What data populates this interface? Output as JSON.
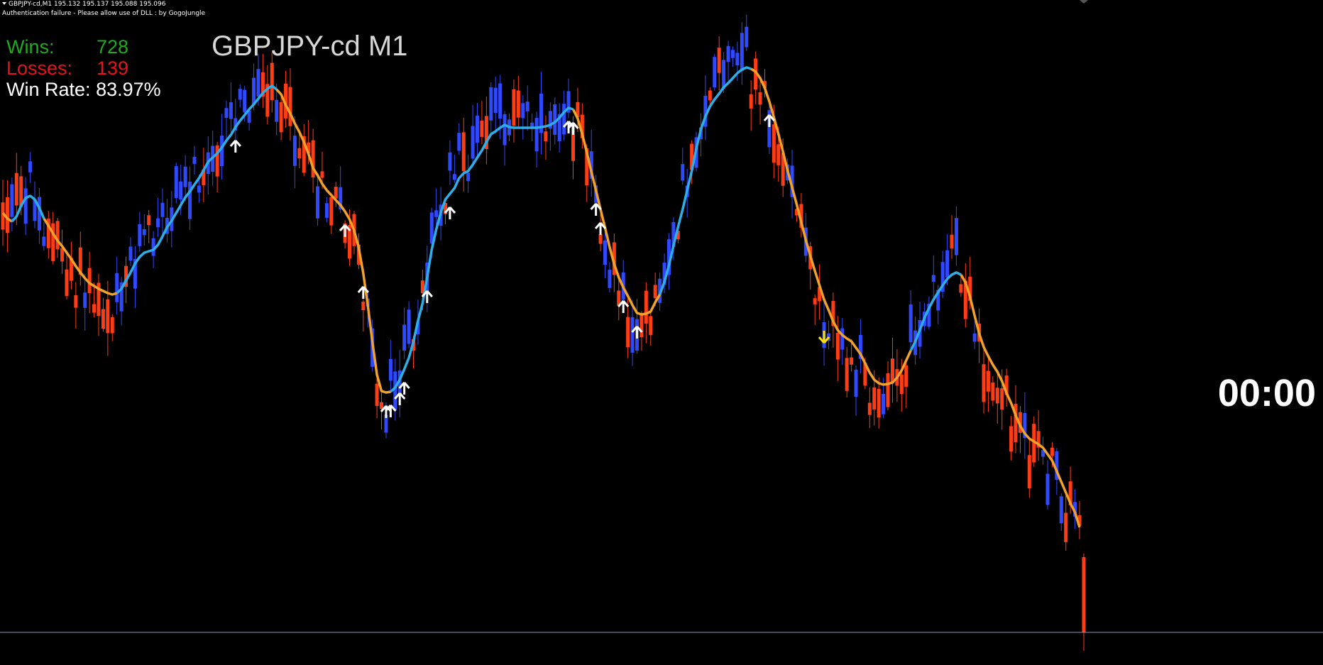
{
  "header": {
    "symbol_line": "GBPJPY-cd,M1  195.132 195.137 195.088 195.096",
    "auth_line": "Authentication failure - Please allow use of DLL : by GogoJungle"
  },
  "stats": {
    "wins_label": "Wins:",
    "wins_value": "728",
    "losses_label": "Losses:",
    "losses_value": "139",
    "winrate_label": "Win Rate:",
    "winrate_value": "83.97%"
  },
  "chart_title": "GBPJPY-cd M1",
  "countdown": "00:00",
  "colors": {
    "background": "#000000",
    "bull_candle": "#2f49ff",
    "bear_candle": "#ff3d14",
    "ma_up": "#2eaee6",
    "ma_down": "#f0a22a",
    "arrow_up": "#ffffff",
    "arrow_down": "#ffe000",
    "current_price_line": "#8d94b8",
    "wins_text": "#1faa1f",
    "losses_text": "#e8121b"
  },
  "icons": {
    "buy_signal": "arrow-up-icon",
    "sell_signal": "arrow-down-icon"
  },
  "chart_data": {
    "type": "candlestick",
    "symbol": "GBPJPY-cd",
    "timeframe": "M1",
    "last_bar": {
      "open": 195.132,
      "high": 195.137,
      "low": 195.088,
      "close": 195.096
    },
    "moving_average_line": [
      300,
      308,
      312,
      305,
      290,
      279,
      276,
      281,
      293,
      308,
      318,
      329,
      339,
      347,
      356,
      365,
      375,
      384,
      392,
      399,
      403,
      407,
      410,
      413,
      415,
      413,
      407,
      395,
      384,
      371,
      362,
      356,
      354,
      352,
      345,
      333,
      320,
      311,
      300,
      289,
      278,
      270,
      260,
      251,
      240,
      228,
      222,
      216,
      208,
      198,
      190,
      179,
      170,
      162,
      154,
      147,
      139,
      131,
      125,
      121,
      126,
      133,
      148,
      160,
      174,
      186,
      200,
      217,
      237,
      247,
      259,
      268,
      275,
      282,
      289,
      298,
      309,
      325,
      349,
      385,
      430,
      482,
      528,
      551,
      553,
      552,
      546,
      535,
      520,
      504,
      481,
      452,
      427,
      391,
      352,
      323,
      299,
      281,
      273,
      265,
      251,
      244,
      241,
      232,
      222,
      212,
      200,
      189,
      185,
      180,
      176,
      179,
      180,
      180,
      180,
      180,
      180,
      180,
      179,
      178,
      176,
      172,
      166,
      158,
      152,
      154,
      167,
      189,
      215,
      242,
      268,
      295,
      321,
      348,
      372,
      391,
      405,
      417,
      430,
      441,
      443,
      442,
      439,
      426,
      415,
      397,
      374,
      346,
      320,
      295,
      268,
      241,
      209,
      182,
      164,
      150,
      140,
      132,
      123,
      117,
      110,
      103,
      98,
      95,
      97,
      101,
      110,
      124,
      143,
      165,
      189,
      214,
      240,
      264,
      288,
      313,
      338,
      361,
      382,
      402,
      422,
      437,
      453,
      465,
      472,
      477,
      481,
      490,
      499,
      512,
      525,
      535,
      540,
      542,
      541,
      539,
      532,
      522,
      508,
      494,
      481,
      465,
      448,
      434,
      422,
      412,
      402,
      393,
      387,
      384,
      387,
      398,
      418,
      445,
      470,
      489,
      502,
      514,
      524,
      537,
      554,
      568,
      585,
      600,
      611,
      618,
      622,
      626,
      631,
      640,
      649,
      664,
      679,
      694,
      709,
      722,
      743
    ],
    "ma_trend": [
      "down",
      "down",
      "up",
      "up",
      "up",
      "up",
      "up",
      "up",
      "up",
      "down",
      "down",
      "down",
      "down",
      "down",
      "down",
      "down",
      "down",
      "down",
      "down",
      "down",
      "down",
      "down",
      "down",
      "down",
      "down",
      "up",
      "up",
      "up",
      "up",
      "up",
      "up",
      "up",
      "up",
      "up",
      "up",
      "up",
      "up",
      "up",
      "up",
      "up",
      "up",
      "up",
      "up",
      "up",
      "up",
      "up",
      "up",
      "up",
      "up",
      "up",
      "up",
      "up",
      "up",
      "up",
      "up",
      "up",
      "up",
      "up",
      "up",
      "up",
      "down",
      "down",
      "down",
      "down",
      "down",
      "down",
      "down",
      "down",
      "down",
      "down",
      "down",
      "down",
      "down",
      "down",
      "down",
      "down",
      "down",
      "down",
      "down",
      "down",
      "down",
      "down",
      "down",
      "down",
      "down",
      "up",
      "up",
      "up",
      "up",
      "up",
      "up",
      "up",
      "up",
      "up",
      "up",
      "up",
      "up",
      "up",
      "up",
      "up",
      "up",
      "up",
      "up",
      "up",
      "up",
      "up",
      "up",
      "up",
      "up",
      "up",
      "up",
      "up",
      "up",
      "up",
      "up",
      "up",
      "up",
      "up",
      "up",
      "up",
      "up",
      "up",
      "up",
      "up",
      "up",
      "down",
      "down",
      "down",
      "down",
      "down",
      "down",
      "down",
      "down",
      "down",
      "down",
      "down",
      "down",
      "down",
      "down",
      "down",
      "down",
      "down",
      "down",
      "down",
      "up",
      "up",
      "up",
      "up",
      "up",
      "up",
      "up",
      "up",
      "up",
      "up",
      "up",
      "up",
      "up",
      "up",
      "up",
      "up",
      "up",
      "up",
      "up",
      "up",
      "down",
      "down",
      "down",
      "down",
      "down",
      "down",
      "down",
      "down",
      "down",
      "down",
      "down",
      "down",
      "down",
      "down",
      "down",
      "down",
      "down",
      "down",
      "down",
      "down",
      "down",
      "down",
      "down",
      "down",
      "down",
      "down",
      "down",
      "down",
      "down",
      "down",
      "down",
      "down",
      "down",
      "down",
      "down",
      "up",
      "up",
      "up",
      "up",
      "up",
      "up",
      "up",
      "up",
      "up",
      "up",
      "up",
      "down",
      "down",
      "down",
      "down",
      "down",
      "down",
      "down",
      "down",
      "down",
      "down",
      "down",
      "down",
      "down",
      "down",
      "down",
      "down",
      "down",
      "down",
      "down",
      "down",
      "down",
      "down",
      "down",
      "down",
      "down",
      "down",
      "down",
      "down",
      "down",
      "down"
    ],
    "buy_signal_bars": [
      51,
      75,
      79,
      84,
      85,
      87,
      88,
      93,
      98,
      124,
      125,
      130,
      131,
      136,
      139,
      168
    ],
    "sell_signal_bars": [
      180
    ]
  }
}
